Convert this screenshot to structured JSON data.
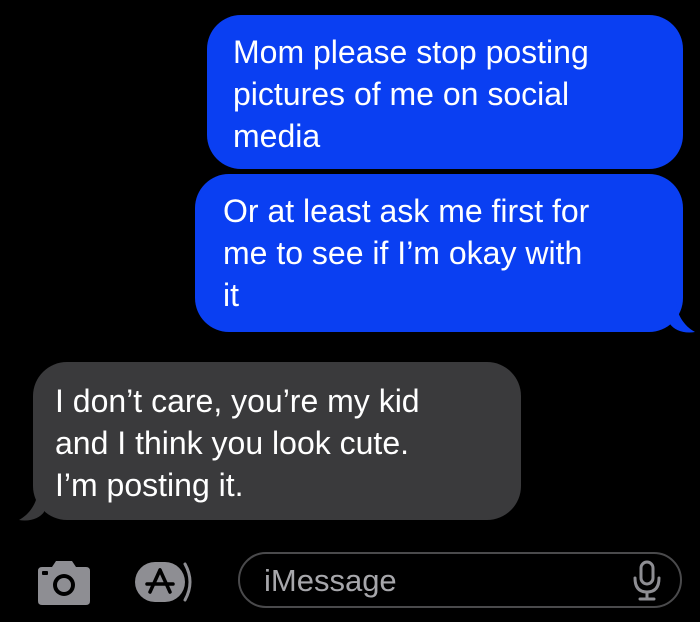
{
  "conversation": {
    "messages": [
      {
        "sender": "me",
        "text": "Mom please stop posting\npictures of me on social\nmedia"
      },
      {
        "sender": "me",
        "text": "Or at least ask me first for\nme to see if I’m okay with\nit"
      },
      {
        "sender": "mom",
        "text": "I don’t care, you’re my kid\nand I think you look cute.\nI’m posting it."
      }
    ]
  },
  "input_bar": {
    "placeholder": "iMessage",
    "icons": [
      "camera-icon",
      "app-store-icon",
      "microphone-icon"
    ]
  },
  "colors": {
    "background": "#000000",
    "sent_bubble": "#0a3ff2",
    "received_bubble": "#3a3a3c",
    "placeholder": "#a7a7ab",
    "icon": "#8e8e93"
  }
}
